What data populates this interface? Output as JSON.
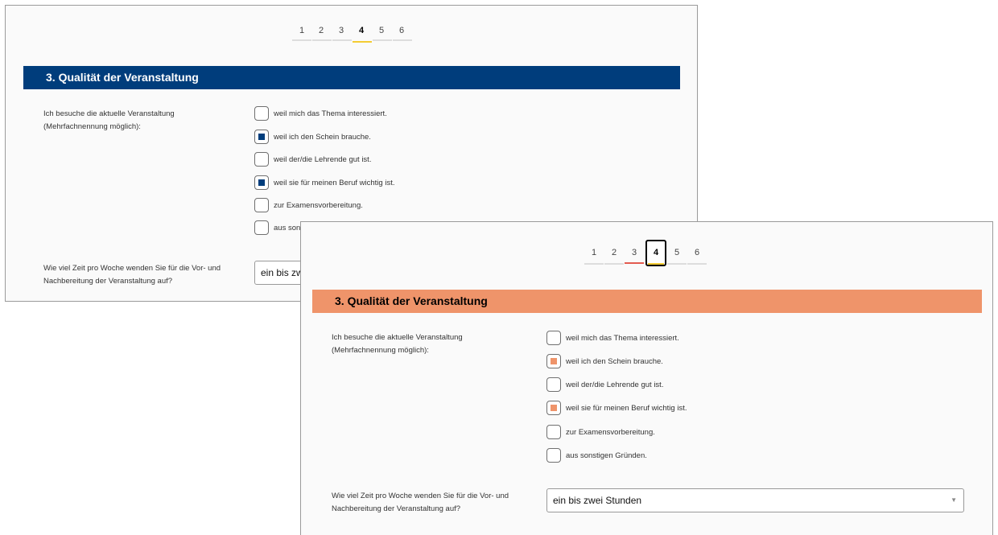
{
  "colors": {
    "back_accent": "#003d7c",
    "front_accent": "#ef946a",
    "pager_underline_back_active": "#f4cc33",
    "pager_underline_front_prev": "#e35b50",
    "pager_underline_front_active": "#f4cc33"
  },
  "pager": {
    "pages": [
      "1",
      "2",
      "3",
      "4",
      "5",
      "6"
    ],
    "current": "4"
  },
  "section": {
    "title": "3. Qualität der Veranstaltung"
  },
  "question1": {
    "line1": "Ich besuche die aktuelle Veranstaltung",
    "line2": "(Mehrfachnennung möglich):",
    "options": [
      {
        "label": "weil mich das Thema interessiert.",
        "checked": false
      },
      {
        "label": "weil ich den Schein brauche.",
        "checked": true
      },
      {
        "label": "weil der/die Lehrende gut ist.",
        "checked": false
      },
      {
        "label": "weil sie für meinen Beruf wichtig ist.",
        "checked": true
      },
      {
        "label": "zur Examensvorbereitung.",
        "checked": false
      },
      {
        "label": "aus sonstigen Gründen.",
        "checked": false
      }
    ],
    "back_last_option_visible": "aus son"
  },
  "question2": {
    "line1": "Wie viel Zeit pro Woche wenden Sie für die Vor- und",
    "line2": "Nachbereitung der Veranstaltung auf?",
    "selected_value": "ein bis zwei Stunden",
    "back_visible_value": "ein bis zw",
    "arrow_icon": "caret-down-icon"
  }
}
